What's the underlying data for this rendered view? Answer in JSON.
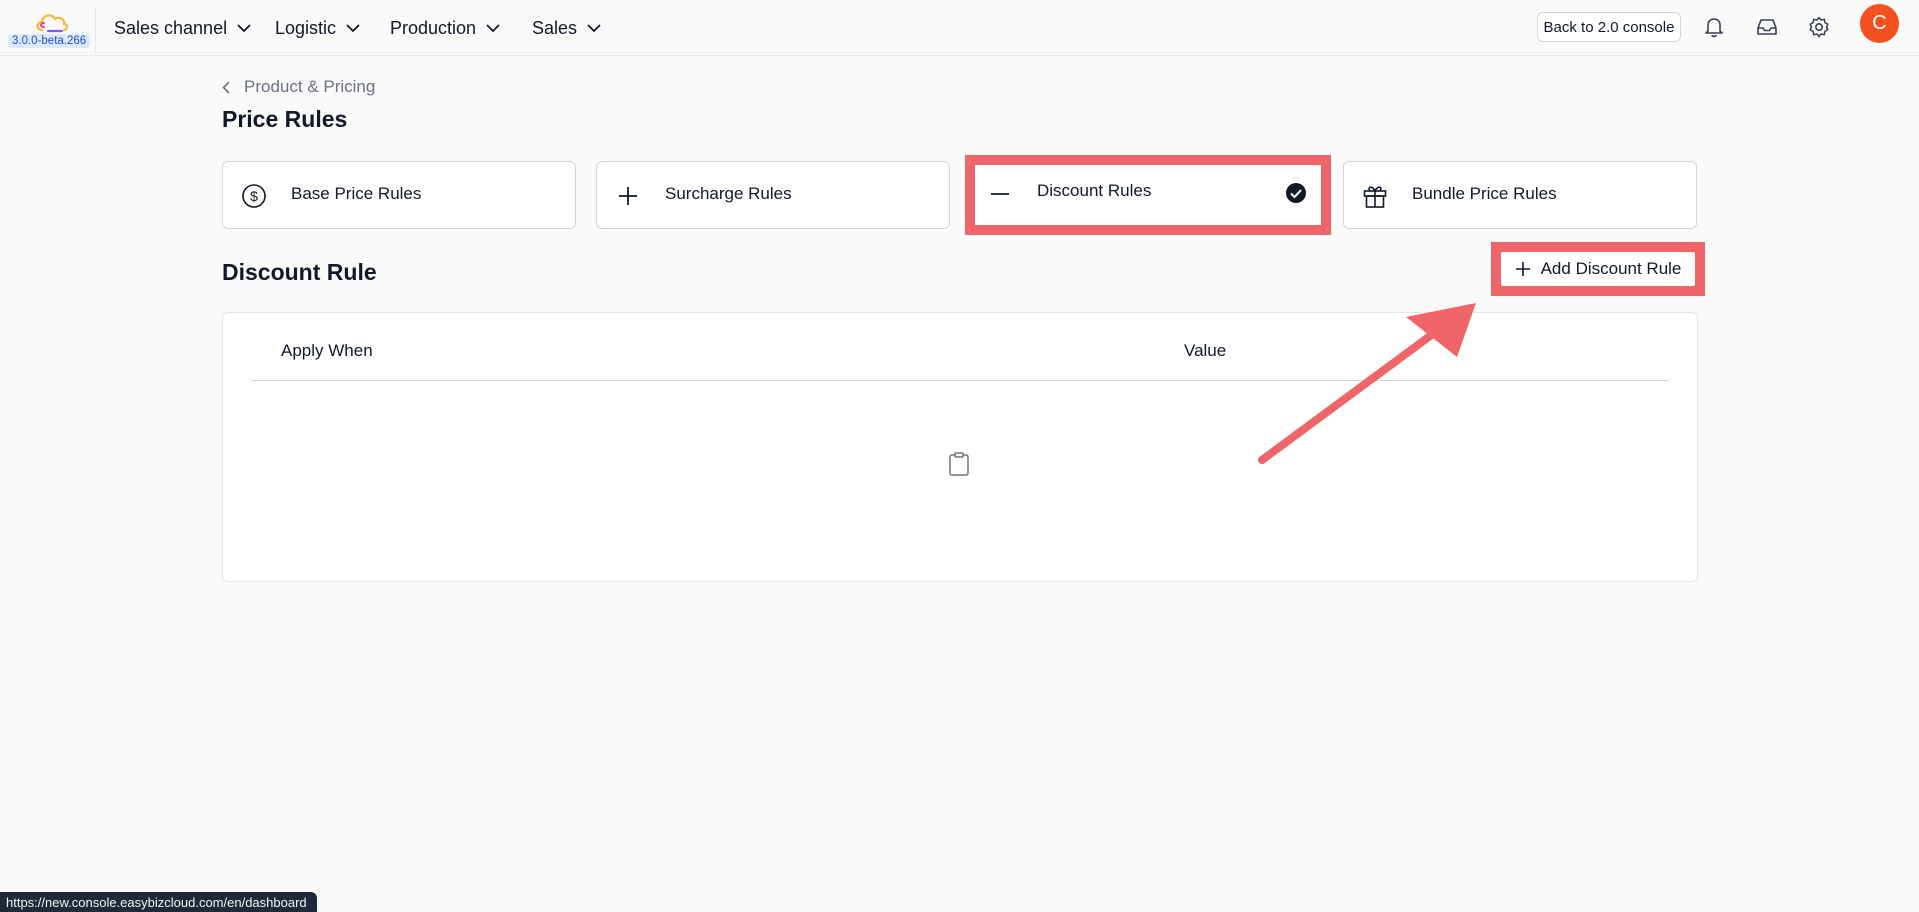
{
  "app": {
    "version": "3.0.0-beta.266"
  },
  "nav": {
    "items": [
      {
        "label": "Sales channel"
      },
      {
        "label": "Logistic"
      },
      {
        "label": "Production"
      },
      {
        "label": "Sales"
      }
    ],
    "back_label": "Back to 2.0 console",
    "avatar_initial": "C"
  },
  "breadcrumb": {
    "label": "Product & Pricing"
  },
  "page": {
    "title": "Price Rules"
  },
  "rule_types": [
    {
      "label": "Base Price Rules",
      "icon": "dollar-circle-icon",
      "selected": false
    },
    {
      "label": "Surcharge Rules",
      "icon": "plus-icon",
      "selected": false
    },
    {
      "label": "Discount Rules",
      "icon": "minus-icon",
      "selected": true
    },
    {
      "label": "Bundle Price Rules",
      "icon": "gift-icon",
      "selected": false
    }
  ],
  "section": {
    "title": "Discount Rule",
    "add_label": "Add Discount Rule"
  },
  "table": {
    "columns": [
      "Apply When",
      "Value"
    ],
    "rows": []
  },
  "status_bar": {
    "url": "https://new.console.easybizcloud.com/en/dashboard"
  },
  "colors": {
    "highlight": "#f0656a",
    "avatar": "#f4511e",
    "version_badge": "#dbeafe"
  }
}
